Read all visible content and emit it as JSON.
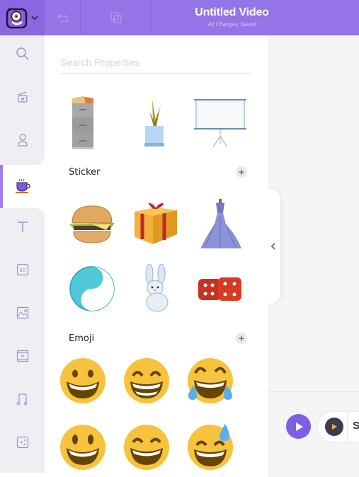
{
  "header": {
    "title": "Untitled Video",
    "subtitle": "All Changes Saved",
    "brand_color": "#9474e6"
  },
  "sidebar": {
    "items": [
      {
        "name": "search",
        "icon": "search-icon"
      },
      {
        "name": "scenes",
        "icon": "clapperboard-icon"
      },
      {
        "name": "characters",
        "icon": "character-icon"
      },
      {
        "name": "properties",
        "icon": "coffee-cup-icon",
        "active": true
      },
      {
        "name": "text",
        "icon": "text-icon"
      },
      {
        "name": "background",
        "icon": "bg-icon",
        "label": "BG"
      },
      {
        "name": "images",
        "icon": "image-icon"
      },
      {
        "name": "video",
        "icon": "film-icon"
      },
      {
        "name": "music",
        "icon": "music-icon"
      },
      {
        "name": "effects",
        "icon": "sparkle-icon"
      }
    ]
  },
  "panel": {
    "search_placeholder": "Search Properties",
    "top_items": [
      "File Cabinet",
      "Plant Pot",
      "Projector Screen"
    ],
    "sections": [
      {
        "title": "Sticker",
        "items": [
          "Burger",
          "Gift Box",
          "Gown",
          "Yin Yang",
          "Bunny",
          "Dice"
        ]
      },
      {
        "title": "Emoji",
        "items": [
          "Grinning Face",
          "Beaming Face",
          "Tears of Joy",
          "Smiley",
          "Grinning Squint",
          "Grinning Sweat"
        ]
      }
    ],
    "add_label": "+"
  },
  "timeline": {
    "pill_label": "S"
  }
}
